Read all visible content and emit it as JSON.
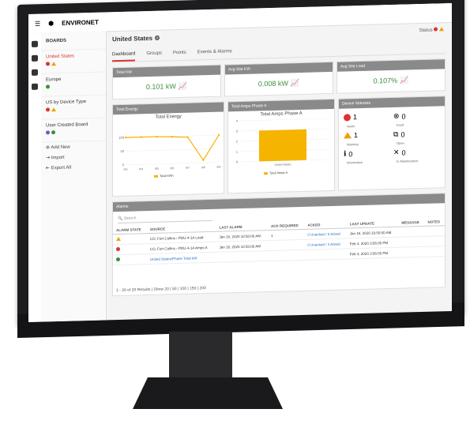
{
  "app": {
    "title": "ENVIRONET"
  },
  "sidebar": {
    "header": "BOARDS",
    "boards": [
      {
        "name": "United States"
      },
      {
        "name": "Europe"
      },
      {
        "name": "US by Device Type"
      },
      {
        "name": "User Created Board"
      }
    ],
    "actions": [
      "Add New",
      "Import",
      "Export All"
    ]
  },
  "main": {
    "title": "United States",
    "status_label": "Status",
    "tabs": [
      "Dashboard",
      "Groups",
      "Points",
      "Events & Alarms"
    ],
    "cards": {
      "total_kw": {
        "title": "Total KW",
        "value": "0.101 kW"
      },
      "avg_site_kw": {
        "title": "Avg Site KW",
        "value": "0.008 kW"
      },
      "avg_site_load": {
        "title": "Avg Site Load",
        "value": "0.107%"
      },
      "total_energy": {
        "title": "Total Energy",
        "chart_title": "Total Energy",
        "legend": "Total kWh"
      },
      "total_amps": {
        "title": "Total Amps Phase A",
        "chart_title": "Total Amps Phase A",
        "legend": "Total Amps A"
      },
      "device_statuses": {
        "title": "Device Statuses",
        "items": [
          {
            "count": "1",
            "label": "Alarm"
          },
          {
            "count": "0",
            "label": "Fault"
          },
          {
            "count": "1",
            "label": "Warning"
          },
          {
            "count": "0",
            "label": "Open"
          },
          {
            "count": "0",
            "label": "Information"
          },
          {
            "count": "0",
            "label": "In Maintenance"
          }
        ]
      }
    },
    "alarms": {
      "title": "Alarms",
      "search_placeholder": "Search",
      "columns": [
        "ALARM STATE",
        "SOURCE",
        "LAST ALARM",
        "ACK REQUIRED",
        "ACKED",
        "LAST UPDATE",
        "MESSAGE",
        "NOTES"
      ],
      "rows": [
        {
          "source": "CO, Fort Collins › PDU-4-1A  Load",
          "last_alarm": "Jan 16, 2020 10:50:00 AM",
          "ack": "1",
          "acked": "0 Unacked / 5 Acked",
          "last_update": "Jan 16, 2020 10:50:00 AM"
        },
        {
          "source": "CO, Fort Collins › PDU-4-1A  Amps A",
          "last_alarm": "Jan 16, 2020 10:50:00 AM",
          "ack": "",
          "acked": "0 Unacked / 3 Acked",
          "last_update": "Feb 4, 2020 3:56:05 PM"
        },
        {
          "source": "United States/Phase Total kW",
          "last_alarm": "",
          "ack": "",
          "acked": "",
          "last_update": "Feb 4, 2020 3:56:05 PM"
        }
      ],
      "pagination": "1 - 20 of 20 Results | Show 20 | 50 | 100 | 150 | 200"
    }
  },
  "chart_data": [
    {
      "type": "line",
      "title": "Total Energy",
      "categories": [
        "9/3",
        "9/4",
        "9/5",
        "9/6",
        "9/7",
        "9/8",
        "9/9"
      ],
      "series": [
        {
          "name": "Total kWh",
          "values": [
            100,
            100,
            100,
            98,
            95,
            10,
            100
          ]
        }
      ],
      "ylim": [
        0,
        150
      ]
    },
    {
      "type": "bar",
      "title": "Total Amps Phase A",
      "categories": [
        "United States"
      ],
      "series": [
        {
          "name": "Total Amps A",
          "values": [
            3
          ]
        }
      ],
      "ylim": [
        0,
        4
      ]
    }
  ],
  "colors": {
    "accent": "#d33333",
    "kpi": "#3c8f3c",
    "chart": "#f5b400"
  }
}
